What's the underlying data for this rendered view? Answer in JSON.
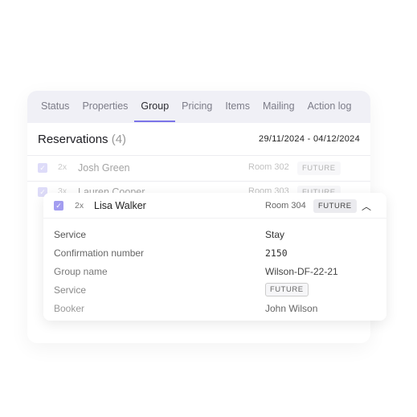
{
  "tabs": [
    "Status",
    "Properties",
    "Group",
    "Pricing",
    "Items",
    "Mailing",
    "Action log"
  ],
  "active_tab": "Group",
  "reservations": {
    "title": "Reservations",
    "count": "(4)",
    "dates": "29/11/2024 - 04/12/2024"
  },
  "rows": [
    {
      "qty": "2x",
      "name": "Josh Green",
      "room": "Room 302",
      "status": "FUTURE",
      "checked": true
    },
    {
      "qty": "3x",
      "name": "Lauren Cooper",
      "room": "Room 303",
      "status": "FUTURE",
      "checked": true
    }
  ],
  "expanded": {
    "qty": "2x",
    "name": "Lisa Walker",
    "room": "Room 304",
    "status": "FUTURE",
    "checked": true,
    "details": [
      {
        "label": "Service",
        "value": "Stay"
      },
      {
        "label": "Confirmation number",
        "value": "2150"
      },
      {
        "label": "Group name",
        "value": "Wilson-DF-22-21"
      },
      {
        "label": "Service",
        "value": "FUTURE"
      },
      {
        "label": "Booker",
        "value": "John Wilson"
      }
    ]
  },
  "colors": {
    "accent": "#7b74e8",
    "checkbox": "#b7b2f2",
    "tab_bg": "#f0f0f6"
  }
}
